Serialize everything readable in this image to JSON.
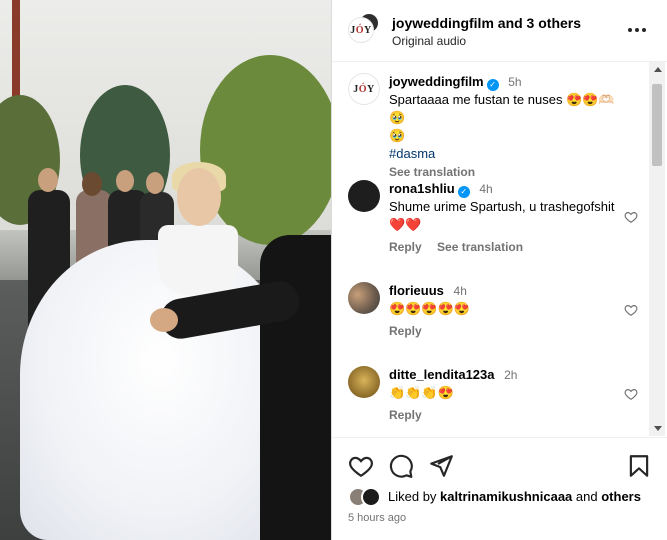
{
  "header": {
    "owner": "joywedding",
    "title_user": "joyweddingfilm",
    "title_suffix": "and 3 others",
    "subtitle": "Original audio",
    "more_icon": "more-horizontal-icon"
  },
  "caption": {
    "user": "joyweddingfilm",
    "time": "5h",
    "text": "Spartaaaa me fustan te nuses 😍😍🫶🏻🥹",
    "text2": "🥹",
    "hashtag": "#dasma",
    "see_translation": "See translation"
  },
  "comments": [
    {
      "user": "rona1shliu",
      "verified": true,
      "time": "4h",
      "text": "Shume urime Spartush, u trashegofshit ❤️❤️",
      "reply": "Reply",
      "see_translation": "See translation"
    },
    {
      "user": "florieuus",
      "verified": false,
      "time": "4h",
      "text": "😍😍😍😍😍",
      "reply": "Reply"
    },
    {
      "user": "ditte_lendita123a",
      "verified": false,
      "time": "2h",
      "text": "👏👏👏😍",
      "reply": "Reply"
    }
  ],
  "actions": {
    "like_icon": "heart-icon",
    "comment_icon": "comment-icon",
    "share_icon": "share-icon",
    "save_icon": "bookmark-icon"
  },
  "likes": {
    "prefix": "Liked by",
    "user": "kaltrinamikushnicaaa",
    "and": "and",
    "others": "others"
  },
  "timestamp": "5 hours ago",
  "colors": {
    "link": "#00376b",
    "verified": "#0095f6",
    "muted": "#737373"
  }
}
